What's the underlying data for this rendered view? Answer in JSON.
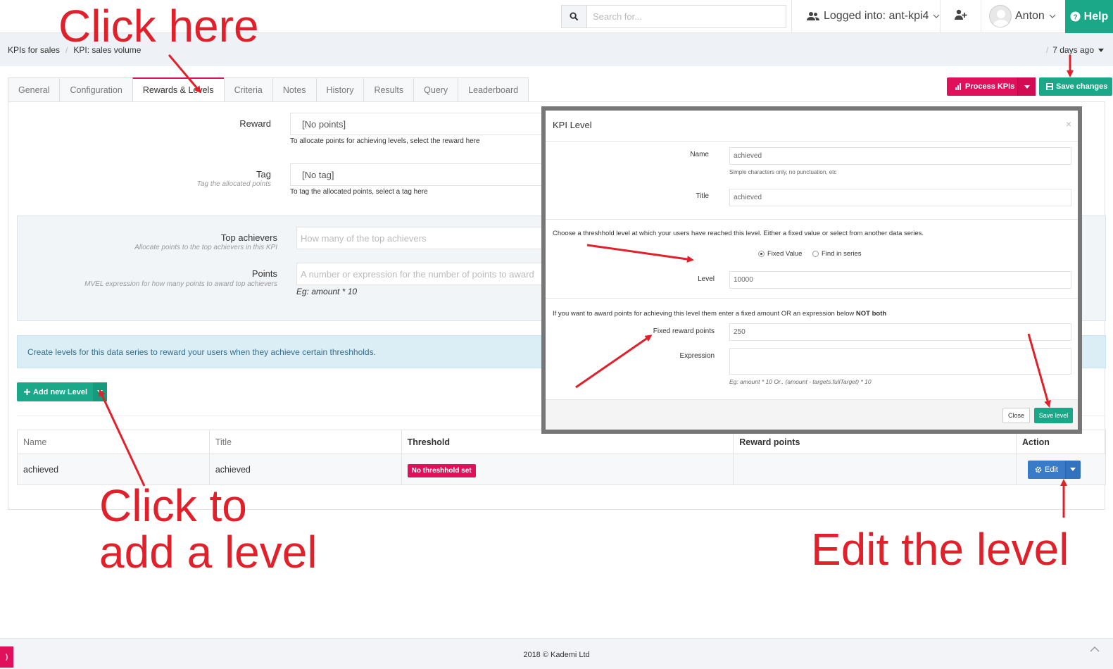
{
  "topbar": {
    "search_placeholder": "Search for...",
    "logged_into": "Logged into: ant-kpi4",
    "user": "Anton",
    "help": "Help"
  },
  "breadcrumb": {
    "items": [
      "KPIs for sales",
      "KPI: sales volume"
    ],
    "separator": "/",
    "time": "7 days ago"
  },
  "actions": {
    "process": "Process KPIs",
    "save": "Save changes"
  },
  "tabs": [
    {
      "label": "General"
    },
    {
      "label": "Configuration"
    },
    {
      "label": "Rewards & Levels",
      "active": true
    },
    {
      "label": "Criteria"
    },
    {
      "label": "Notes"
    },
    {
      "label": "History"
    },
    {
      "label": "Results"
    },
    {
      "label": "Query"
    },
    {
      "label": "Leaderboard"
    }
  ],
  "form": {
    "reward_label": "Reward",
    "reward_value": "[No points]",
    "reward_help": "To allocate points for achieving levels, select the reward here",
    "tag_label": "Tag",
    "tag_hint": "Tag the allocated points",
    "tag_value": "[No tag]",
    "tag_help": "To tag the allocated points, select a tag here",
    "top_label": "Top achievers",
    "top_hint": "Allocate points to the top achievers in this KPI",
    "top_placeholder": "How many of the top achievers",
    "points_label": "Points",
    "points_hint": "MVEL expression for how many points to award top achievers",
    "points_placeholder": "A number or expression for the number of points to award",
    "points_example": "Eg: amount * 10"
  },
  "info": "Create levels for this data series to reward your users when they achieve certain threshholds.",
  "add_level": "Add new Level",
  "table": {
    "headers": [
      "Name",
      "Title",
      "Threshold",
      "Reward points",
      "Action"
    ],
    "rows": [
      {
        "name": "achieved",
        "title": "achieved",
        "threshold": "No threshhold set",
        "reward": "",
        "action": "Edit"
      }
    ]
  },
  "modal": {
    "title": "KPI Level",
    "close_x": "×",
    "name_label": "Name",
    "name_value": "achieved",
    "name_help": "Simple characters only, no punctuation, etc",
    "title_label": "Title",
    "title_value": "achieved",
    "threshold_text": "Choose a threshhold level at which your users have reached this level. Either a fixed value or select from another data series.",
    "radio_fixed": "Fixed Value",
    "radio_series": "Find in series",
    "level_label": "Level",
    "level_value": "10000",
    "award_text": "If you want to award points for achieving this level them enter a fixed amount OR an expression below",
    "award_text_bold": "NOT both",
    "fixed_label": "Fixed reward points",
    "fixed_value": "250",
    "expr_label": "Expression",
    "expr_help": "Eg: amount * 10 Or.. (amount - targets.fullTarget) * 10",
    "close_btn": "Close",
    "save_btn": "Save level"
  },
  "annotations": {
    "click_here": "Click here",
    "add_level_line1": "Click to",
    "add_level_line2": "add a level",
    "edit_level": "Edit the level"
  },
  "footer": {
    "copyright": "2018 © Kademi Ltd",
    "badge": ")"
  },
  "colors": {
    "accent_green": "#1aa889",
    "accent_pink": "#e0105b",
    "edit_blue": "#3a7bc8",
    "annotation_red": "#e0202a"
  }
}
